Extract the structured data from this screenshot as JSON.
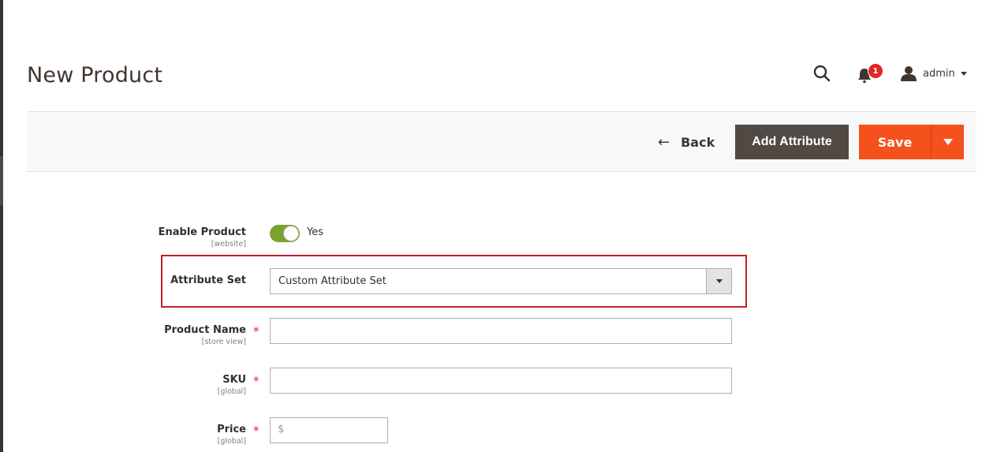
{
  "header": {
    "title": "New Product",
    "notifications_count": "1",
    "user_name": "admin"
  },
  "action_bar": {
    "back_label": "Back",
    "back_arrow": "←",
    "add_attribute_label": "Add Attribute",
    "save_label": "Save"
  },
  "form": {
    "enable_product": {
      "label": "Enable Product",
      "scope": "[website]",
      "value": "Yes",
      "enabled": true
    },
    "attribute_set": {
      "label": "Attribute Set",
      "value": "Custom Attribute Set"
    },
    "product_name": {
      "label": "Product Name",
      "scope": "[store view]",
      "required": "*",
      "value": ""
    },
    "sku": {
      "label": "SKU",
      "scope": "[global]",
      "required": "*",
      "value": ""
    },
    "price": {
      "label": "Price",
      "scope": "[global]",
      "required": "*",
      "currency_symbol": "$",
      "value": ""
    }
  },
  "colors": {
    "accent_orange": "#f4511d",
    "dark_button": "#514943",
    "toggle_on": "#79a22e",
    "highlight_red": "#c81e24",
    "required_red": "#e22626"
  }
}
